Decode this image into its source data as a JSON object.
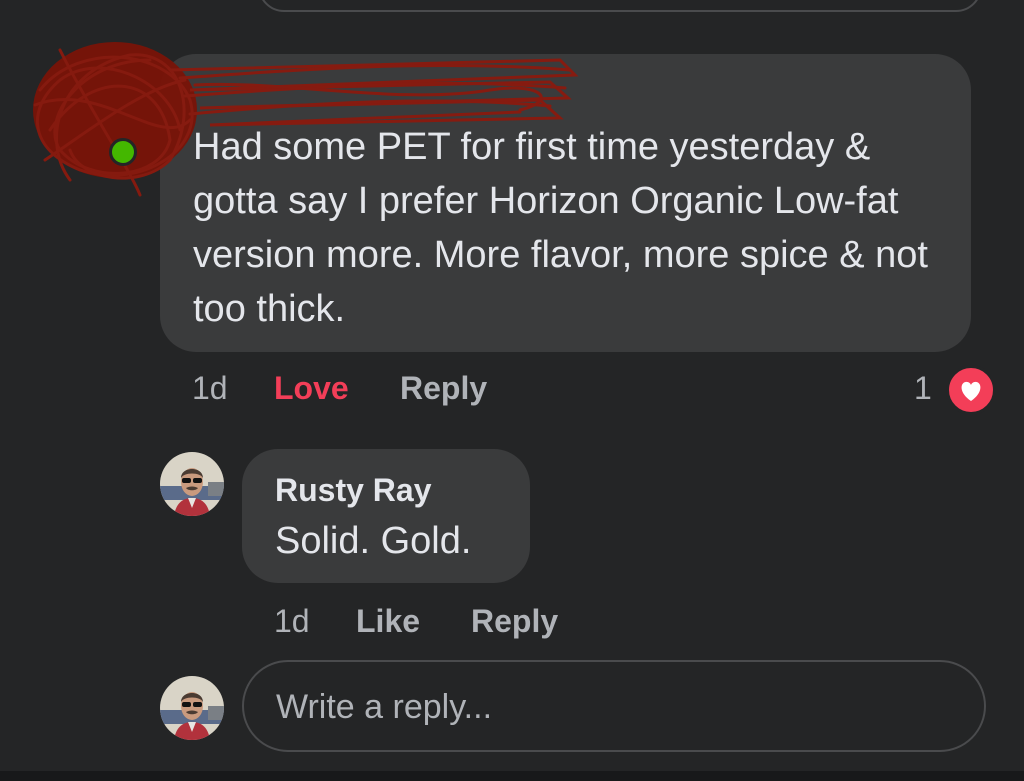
{
  "comment": {
    "text": "Had some PET for first time yesterday & gotta say I prefer Horizon Organic Low-fat version more. More flavor, more spice & not too thick.",
    "time": "1d",
    "love_label": "Love",
    "reply_label": "Reply",
    "reaction_count": "1",
    "reaction_icon": "heart-icon",
    "online_color": "#44b700"
  },
  "reply": {
    "author": "Rusty Ray",
    "text": "Solid. Gold.",
    "time": "1d",
    "like_label": "Like",
    "reply_label": "Reply"
  },
  "composer": {
    "placeholder": "Write a reply..."
  },
  "colors": {
    "background": "#242526",
    "bubble": "#3a3b3c",
    "love": "#f33e58",
    "muted_text": "#b0b3b8"
  }
}
